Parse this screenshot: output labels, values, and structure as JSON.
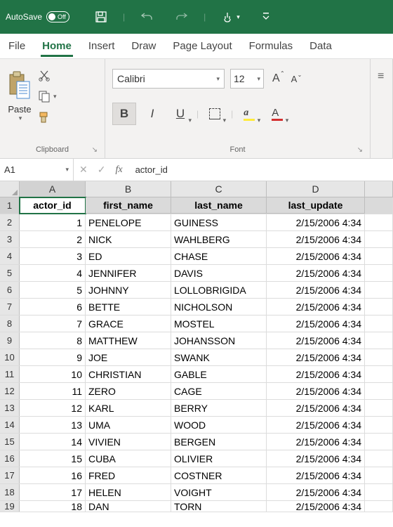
{
  "titlebar": {
    "autosave_label": "AutoSave",
    "autosave_state": "Off"
  },
  "tabs": [
    "File",
    "Home",
    "Insert",
    "Draw",
    "Page Layout",
    "Formulas",
    "Data"
  ],
  "active_tab": "Home",
  "ribbon": {
    "clipboard_label": "Clipboard",
    "paste_label": "Paste",
    "font_label": "Font",
    "font_name": "Calibri",
    "font_size": "12"
  },
  "formula_bar": {
    "namebox": "A1",
    "value": "actor_id"
  },
  "columns": [
    "A",
    "B",
    "C",
    "D"
  ],
  "selected_col": "A",
  "selected_row": 1,
  "headers": [
    "actor_id",
    "first_name",
    "last_name",
    "last_update"
  ],
  "rows": [
    {
      "id": "1",
      "first": "PENELOPE",
      "last": "GUINESS",
      "ts": "2/15/2006 4:34"
    },
    {
      "id": "2",
      "first": "NICK",
      "last": "WAHLBERG",
      "ts": "2/15/2006 4:34"
    },
    {
      "id": "3",
      "first": "ED",
      "last": "CHASE",
      "ts": "2/15/2006 4:34"
    },
    {
      "id": "4",
      "first": "JENNIFER",
      "last": "DAVIS",
      "ts": "2/15/2006 4:34"
    },
    {
      "id": "5",
      "first": "JOHNNY",
      "last": "LOLLOBRIGIDA",
      "ts": "2/15/2006 4:34"
    },
    {
      "id": "6",
      "first": "BETTE",
      "last": "NICHOLSON",
      "ts": "2/15/2006 4:34"
    },
    {
      "id": "7",
      "first": "GRACE",
      "last": "MOSTEL",
      "ts": "2/15/2006 4:34"
    },
    {
      "id": "8",
      "first": "MATTHEW",
      "last": "JOHANSSON",
      "ts": "2/15/2006 4:34"
    },
    {
      "id": "9",
      "first": "JOE",
      "last": "SWANK",
      "ts": "2/15/2006 4:34"
    },
    {
      "id": "10",
      "first": "CHRISTIAN",
      "last": "GABLE",
      "ts": "2/15/2006 4:34"
    },
    {
      "id": "11",
      "first": "ZERO",
      "last": "CAGE",
      "ts": "2/15/2006 4:34"
    },
    {
      "id": "12",
      "first": "KARL",
      "last": "BERRY",
      "ts": "2/15/2006 4:34"
    },
    {
      "id": "13",
      "first": "UMA",
      "last": "WOOD",
      "ts": "2/15/2006 4:34"
    },
    {
      "id": "14",
      "first": "VIVIEN",
      "last": "BERGEN",
      "ts": "2/15/2006 4:34"
    },
    {
      "id": "15",
      "first": "CUBA",
      "last": "OLIVIER",
      "ts": "2/15/2006 4:34"
    },
    {
      "id": "16",
      "first": "FRED",
      "last": "COSTNER",
      "ts": "2/15/2006 4:34"
    },
    {
      "id": "17",
      "first": "HELEN",
      "last": "VOIGHT",
      "ts": "2/15/2006 4:34"
    },
    {
      "id": "18",
      "first": "DAN",
      "last": "TORN",
      "ts": "2/15/2006 4:34"
    }
  ]
}
